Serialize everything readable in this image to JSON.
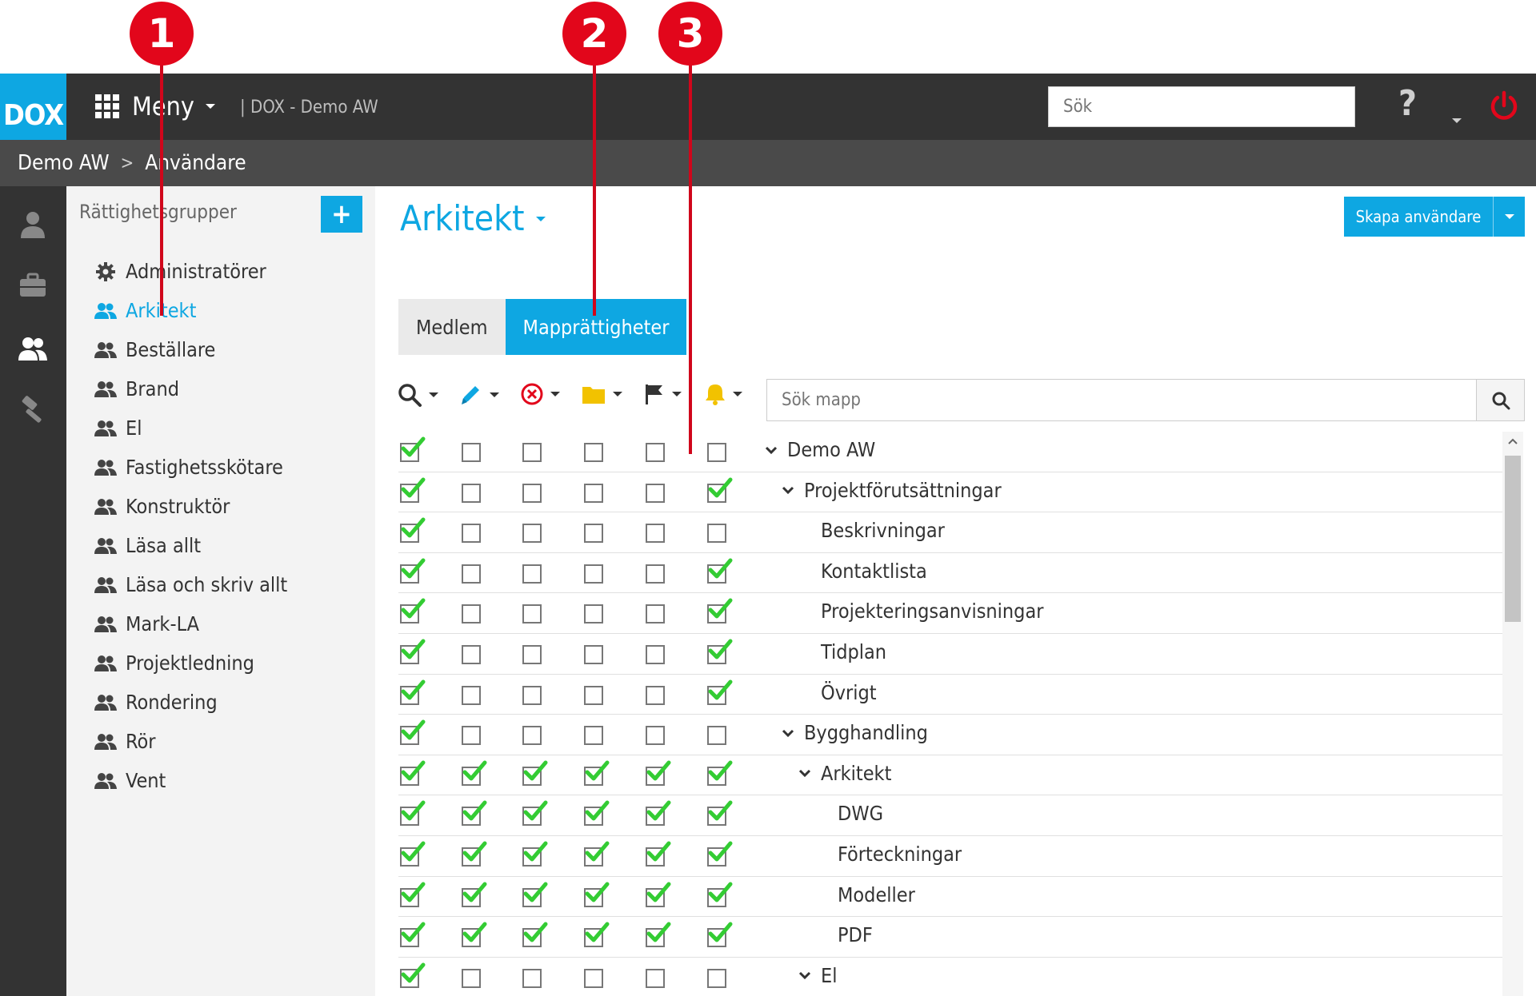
{
  "annotations": [
    "1",
    "2",
    "3"
  ],
  "header": {
    "logo": "DOX",
    "menu_label": "Meny",
    "app_title": "| DOX - Demo AW",
    "search_placeholder": "Sök"
  },
  "breadcrumb": [
    "Demo AW",
    "Användare"
  ],
  "groups_panel": {
    "title": "Rättighetsgrupper",
    "add_label": "+",
    "items": [
      {
        "label": "Administratörer",
        "icon": "gear-icon"
      },
      {
        "label": "Arkitekt",
        "icon": "users-icon",
        "active": true
      },
      {
        "label": "Beställare",
        "icon": "users-icon"
      },
      {
        "label": "Brand",
        "icon": "users-icon"
      },
      {
        "label": "El",
        "icon": "users-icon"
      },
      {
        "label": "Fastighetsskötare",
        "icon": "users-icon"
      },
      {
        "label": "Konstruktör",
        "icon": "users-icon"
      },
      {
        "label": "Läsa allt",
        "icon": "users-icon"
      },
      {
        "label": "Läsa och skriv allt",
        "icon": "users-icon"
      },
      {
        "label": "Mark-LA",
        "icon": "users-icon"
      },
      {
        "label": "Projektledning",
        "icon": "users-icon"
      },
      {
        "label": "Rondering",
        "icon": "users-icon"
      },
      {
        "label": "Rör",
        "icon": "users-icon"
      },
      {
        "label": "Vent",
        "icon": "users-icon"
      }
    ]
  },
  "main": {
    "title": "Arkitekt",
    "create_button": "Skapa användare",
    "tabs": [
      {
        "label": "Medlem",
        "active": false
      },
      {
        "label": "Mapprättigheter",
        "active": true
      }
    ],
    "toolbar_icons": [
      "search-icon",
      "pencil-icon",
      "delete-circle-icon",
      "folder-icon",
      "flag-icon",
      "bell-icon"
    ],
    "folder_search_placeholder": "Sök mapp",
    "colors": {
      "accent": "#0ea7e2",
      "dark_bar": "#333333",
      "breadcrumb_bar": "#4a4a4a",
      "check_green": "#33cc33",
      "delete_red": "#e2061b",
      "folder_yellow": "#f2c200",
      "annotation_red": "#e2061b"
    },
    "rows": [
      {
        "label": "Demo AW",
        "level": 0,
        "expanded": true,
        "perms": [
          true,
          false,
          false,
          false,
          false,
          false
        ]
      },
      {
        "label": "Projektförutsättningar",
        "level": 1,
        "expanded": true,
        "perms": [
          true,
          false,
          false,
          false,
          false,
          true
        ]
      },
      {
        "label": "Beskrivningar",
        "level": 2,
        "perms": [
          true,
          false,
          false,
          false,
          false,
          false
        ]
      },
      {
        "label": "Kontaktlista",
        "level": 2,
        "perms": [
          true,
          false,
          false,
          false,
          false,
          true
        ]
      },
      {
        "label": "Projekteringsanvisningar",
        "level": 2,
        "perms": [
          true,
          false,
          false,
          false,
          false,
          true
        ]
      },
      {
        "label": "Tidplan",
        "level": 2,
        "perms": [
          true,
          false,
          false,
          false,
          false,
          true
        ]
      },
      {
        "label": "Övrigt",
        "level": 2,
        "perms": [
          true,
          false,
          false,
          false,
          false,
          true
        ]
      },
      {
        "label": "Bygghandling",
        "level": 1,
        "expanded": true,
        "perms": [
          true,
          false,
          false,
          false,
          false,
          false
        ]
      },
      {
        "label": "Arkitekt",
        "level": 2,
        "expanded": true,
        "perms": [
          true,
          true,
          true,
          true,
          true,
          true
        ]
      },
      {
        "label": "DWG",
        "level": 3,
        "perms": [
          true,
          true,
          true,
          true,
          true,
          true
        ]
      },
      {
        "label": "Förteckningar",
        "level": 3,
        "perms": [
          true,
          true,
          true,
          true,
          true,
          true
        ]
      },
      {
        "label": "Modeller",
        "level": 3,
        "perms": [
          true,
          true,
          true,
          true,
          true,
          true
        ]
      },
      {
        "label": "PDF",
        "level": 3,
        "perms": [
          true,
          true,
          true,
          true,
          true,
          true
        ]
      },
      {
        "label": "El",
        "level": 2,
        "expanded": true,
        "perms": [
          true,
          false,
          false,
          false,
          false,
          false
        ]
      }
    ]
  }
}
